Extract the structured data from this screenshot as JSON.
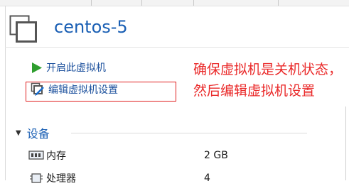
{
  "vm": {
    "title": "centos-5",
    "icon": "vm-windows-icon"
  },
  "actions": {
    "power_on": {
      "label": "开启此虚拟机",
      "icon": "play-icon",
      "color": "#2e9e2e"
    },
    "edit": {
      "label": "编辑虚拟机设置",
      "icon": "edit-settings-icon"
    }
  },
  "annotation": {
    "text": "确保虚拟机是关机状态，然后编辑虚拟机设置",
    "color": "#ea2a2a"
  },
  "devices": {
    "section_label": "设备",
    "rows": [
      {
        "name": "内存",
        "value": "2 GB",
        "icon": "memory-icon"
      },
      {
        "name": "处理器",
        "value": "4",
        "icon": "processor-icon"
      }
    ]
  },
  "colors": {
    "link_blue": "#1a4f9c",
    "title_blue": "#1a5fb4",
    "highlight_red": "#e02020"
  }
}
